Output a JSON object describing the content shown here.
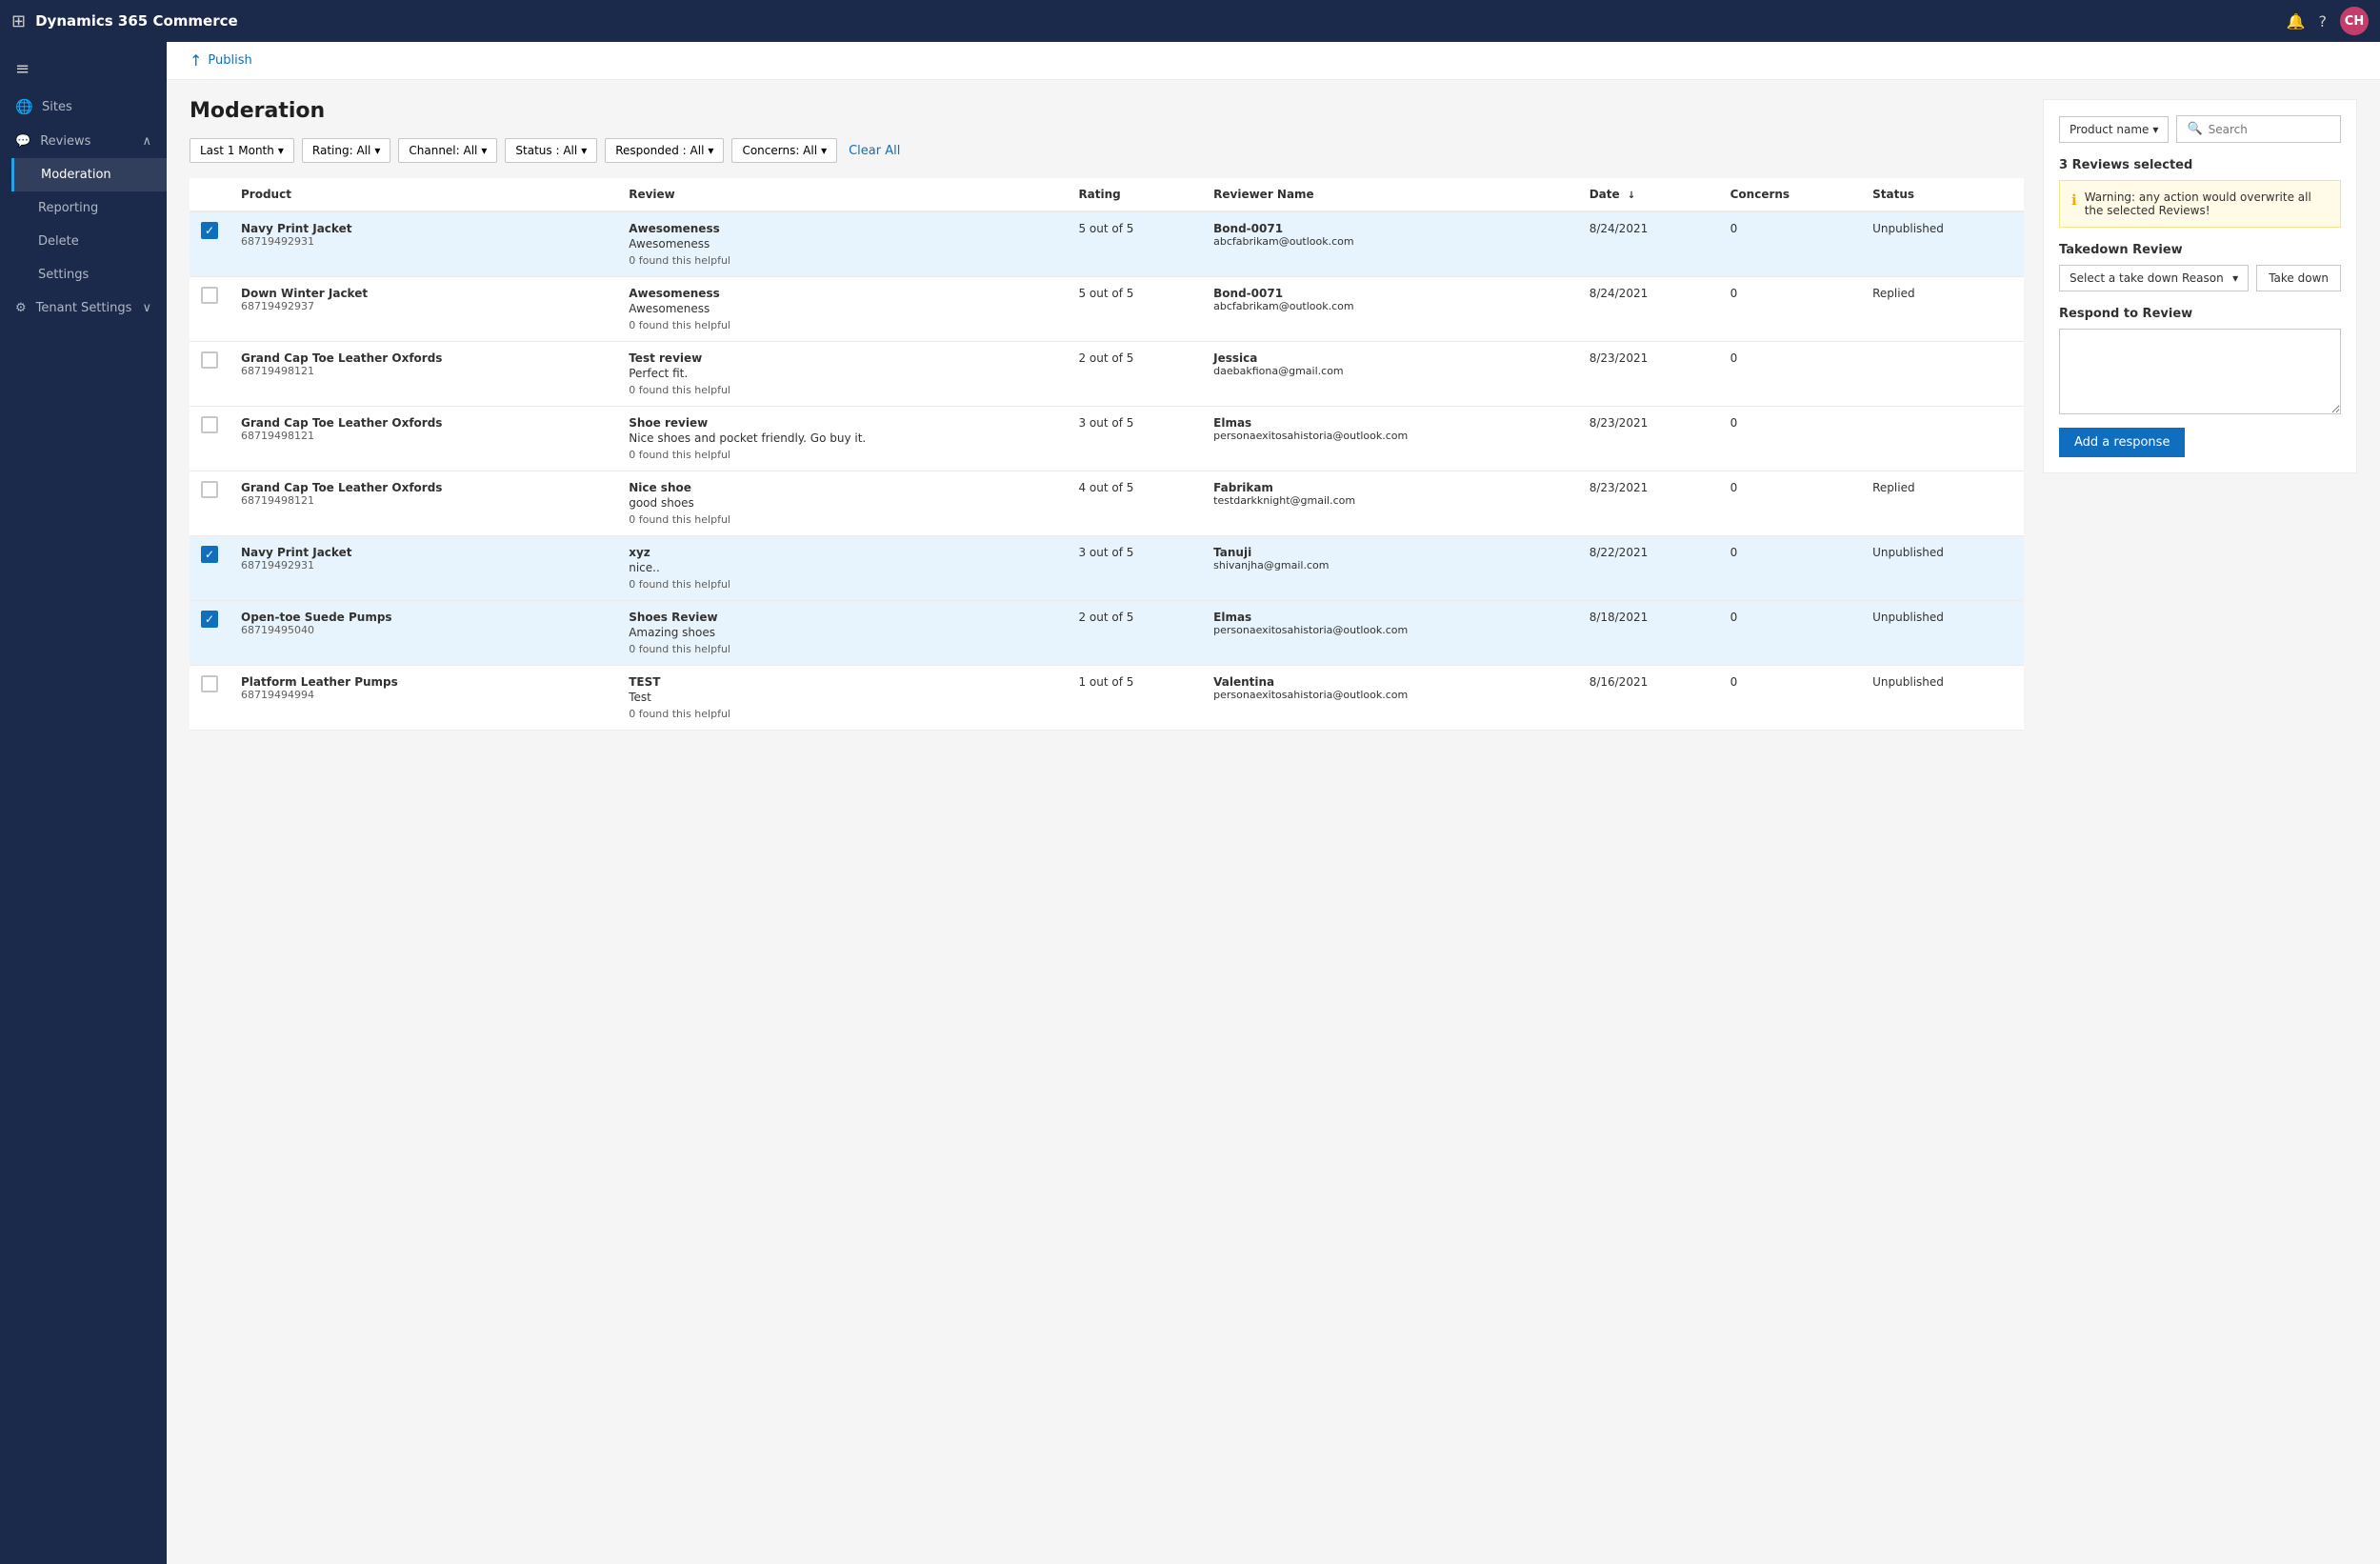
{
  "app": {
    "title": "Dynamics 365 Commerce",
    "avatar": "CH"
  },
  "topnav": {
    "notification_icon": "🔔",
    "help_icon": "?",
    "avatar_initials": "CH"
  },
  "sidebar": {
    "menu_icon": "≡",
    "items": [
      {
        "id": "sites",
        "label": "Sites",
        "icon": "🌐"
      },
      {
        "id": "reviews",
        "label": "Reviews",
        "icon": "💬",
        "expandable": true
      },
      {
        "id": "moderation",
        "label": "Moderation",
        "active": true
      },
      {
        "id": "reporting",
        "label": "Reporting"
      },
      {
        "id": "delete",
        "label": "Delete"
      },
      {
        "id": "settings",
        "label": "Settings"
      },
      {
        "id": "tenant-settings",
        "label": "Tenant Settings",
        "icon": "⚙",
        "expandable": true
      }
    ]
  },
  "publish_bar": {
    "button_label": "Publish"
  },
  "page": {
    "title": "Moderation"
  },
  "filters": {
    "date_label": "Last 1 Month",
    "rating_label": "Rating: All",
    "channel_label": "Channel: All",
    "status_label": "Status : All",
    "responded_label": "Responded : All",
    "concerns_label": "Concerns: All",
    "clear_all_label": "Clear All"
  },
  "table": {
    "columns": [
      "",
      "Product",
      "Review",
      "Rating",
      "Reviewer Name",
      "Date",
      "Concerns",
      "Status"
    ],
    "rows": [
      {
        "selected": true,
        "product_name": "Navy Print Jacket",
        "product_id": "68719492931",
        "review_title": "Awesomeness",
        "review_text": "Awesomeness",
        "helpful": "0 found this helpful",
        "rating": "5 out of 5",
        "reviewer_name": "Bond-0071",
        "reviewer_email": "abcfabrikam@outlook.com",
        "date": "8/24/2021",
        "concerns": "0",
        "status": "Unpublished"
      },
      {
        "selected": false,
        "product_name": "Down Winter Jacket",
        "product_id": "68719492937",
        "review_title": "Awesomeness",
        "review_text": "Awesomeness",
        "helpful": "0 found this helpful",
        "rating": "5 out of 5",
        "reviewer_name": "Bond-0071",
        "reviewer_email": "abcfabrikam@outlook.com",
        "date": "8/24/2021",
        "concerns": "0",
        "status": "Replied"
      },
      {
        "selected": false,
        "product_name": "Grand Cap Toe Leather Oxfords",
        "product_id": "68719498121",
        "review_title": "Test review",
        "review_text": "Perfect fit.",
        "helpful": "0 found this helpful",
        "rating": "2 out of 5",
        "reviewer_name": "Jessica",
        "reviewer_email": "daebakfiona@gmail.com",
        "date": "8/23/2021",
        "concerns": "0",
        "status": ""
      },
      {
        "selected": false,
        "product_name": "Grand Cap Toe Leather Oxfords",
        "product_id": "68719498121",
        "review_title": "Shoe review",
        "review_text": "Nice shoes and pocket friendly. Go buy it.",
        "helpful": "0 found this helpful",
        "rating": "3 out of 5",
        "reviewer_name": "Elmas",
        "reviewer_email": "personaexitosahistoria@outlook.com",
        "date": "8/23/2021",
        "concerns": "0",
        "status": ""
      },
      {
        "selected": false,
        "product_name": "Grand Cap Toe Leather Oxfords",
        "product_id": "68719498121",
        "review_title": "Nice shoe",
        "review_text": "good shoes",
        "helpful": "0 found this helpful",
        "rating": "4 out of 5",
        "reviewer_name": "Fabrikam",
        "reviewer_email": "testdarkknight@gmail.com",
        "date": "8/23/2021",
        "concerns": "0",
        "status": "Replied"
      },
      {
        "selected": true,
        "product_name": "Navy Print Jacket",
        "product_id": "68719492931",
        "review_title": "xyz",
        "review_text": "nice..",
        "helpful": "0 found this helpful",
        "rating": "3 out of 5",
        "reviewer_name": "Tanuji",
        "reviewer_email": "shivanjha@gmail.com",
        "date": "8/22/2021",
        "concerns": "0",
        "status": "Unpublished"
      },
      {
        "selected": true,
        "product_name": "Open-toe Suede Pumps",
        "product_id": "68719495040",
        "review_title": "Shoes Review",
        "review_text": "Amazing shoes",
        "helpful": "0 found this helpful",
        "rating": "2 out of 5",
        "reviewer_name": "Elmas",
        "reviewer_email": "personaexitosahistoria@outlook.com",
        "date": "8/18/2021",
        "concerns": "0",
        "status": "Unpublished"
      },
      {
        "selected": false,
        "product_name": "Platform Leather Pumps",
        "product_id": "68719494994",
        "review_title": "TEST",
        "review_text": "Test",
        "helpful": "0 found this helpful",
        "rating": "1 out of 5",
        "reviewer_name": "Valentina",
        "reviewer_email": "personaexitosahistoria@outlook.com",
        "date": "8/16/2021",
        "concerns": "0",
        "status": "Unpublished"
      }
    ]
  },
  "right_panel": {
    "product_name_label": "Product name",
    "search_placeholder": "Search",
    "selected_count_label": "3 Reviews selected",
    "warning_text": "Warning: any action would overwrite all the selected Reviews!",
    "takedown_section_label": "Takedown Review",
    "takedown_placeholder": "Select a take down Reason",
    "takedown_button_label": "Take down",
    "respond_section_label": "Respond to Review",
    "respond_placeholder": "",
    "add_response_button_label": "Add a response"
  }
}
